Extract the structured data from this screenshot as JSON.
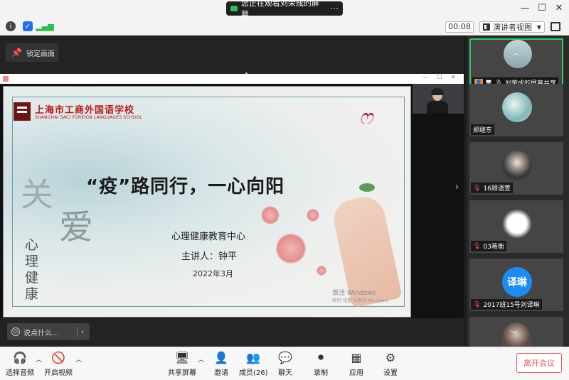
{
  "titlebar": {
    "sharing_notice": "您正在观看刘荣成的屏幕",
    "more_icon": "more-icon"
  },
  "infobar": {
    "timer": "00:08",
    "view_mode": "演讲者视图"
  },
  "main": {
    "lock_label": "锁定画面",
    "chat_placeholder": "说点什么..."
  },
  "slide": {
    "school_name": "上海市工商外国语学校",
    "school_name_en": "SHANGHAI SACI FOREIGN LANGUAGES SCHOOL",
    "big_char_1": "关",
    "big_char_2": "爱",
    "vertical_text": "心理健康",
    "title": "“疫”路同行，一心向阳",
    "subtitle": "心理健康教育中心",
    "presenter": "主讲人：钟平",
    "date": "2022年3月",
    "activate": "激活 Windows",
    "activate_sub": "转到“设置”以激活 Windows。"
  },
  "sidebar": {
    "tiles": [
      {
        "name": "刘荣成的屏幕共享"
      },
      {
        "name": "郑继东"
      },
      {
        "name": "16顾语萱"
      },
      {
        "name": "03蒋衡"
      },
      {
        "name": "2017班15号刘译琳",
        "avatar_text": "译琳"
      }
    ]
  },
  "toolbar": {
    "audio": "选择音频",
    "video": "开启视频",
    "share": "共享屏幕",
    "invite": "邀请",
    "members": "成员(26)",
    "chat": "聊天",
    "record": "录制",
    "apps": "应用",
    "settings": "设置",
    "leave": "离开会议"
  },
  "colors": {
    "accent_green": "#36c96b",
    "leave_red": "#e25a5a",
    "avatar_blue": "#1e8bf5"
  }
}
